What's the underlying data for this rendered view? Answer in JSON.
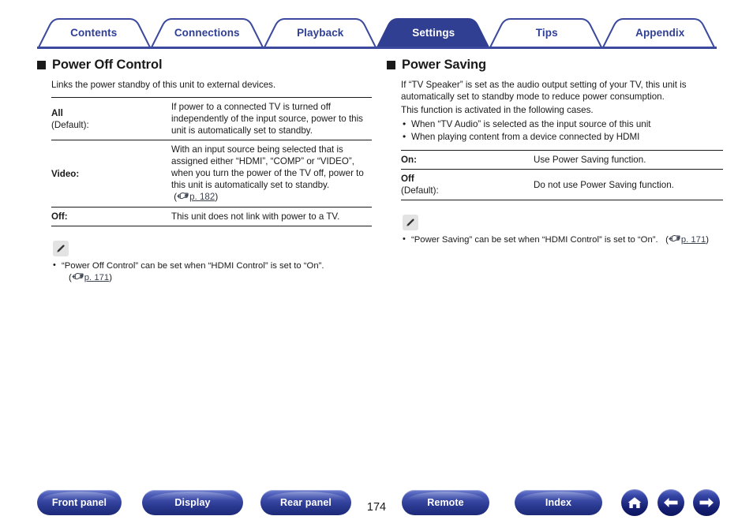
{
  "nav": {
    "tabs": [
      {
        "label": "Contents",
        "active": false
      },
      {
        "label": "Connections",
        "active": false
      },
      {
        "label": "Playback",
        "active": false
      },
      {
        "label": "Settings",
        "active": true
      },
      {
        "label": "Tips",
        "active": false
      },
      {
        "label": "Appendix",
        "active": false
      }
    ]
  },
  "left": {
    "title": "Power Off Control",
    "lead": "Links the power standby of this unit to external devices.",
    "table": [
      {
        "option": "All",
        "option_suffix": "(Default):",
        "desc": "If power to a connected TV is turned off independently of the input source, power to this unit is automatically set to standby."
      },
      {
        "option": "Video:",
        "option_suffix": "",
        "desc": "With an input source being selected that is assigned either “HDMI”, “COMP” or “VIDEO”, when you turn the power of the TV off, power to this unit is automatically set to standby.",
        "ref": "p. 182"
      },
      {
        "option": "Off:",
        "option_suffix": "",
        "desc": "This unit does not link with power to a TV."
      }
    ],
    "note": {
      "text": "“Power Off Control” can be set when “HDMI Control” is set to “On”.",
      "ref": "p. 171"
    }
  },
  "right": {
    "title": "Power Saving",
    "lead": "If “TV Speaker” is set as the audio output setting of your TV, this unit is automatically set to standby mode to reduce power consumption.",
    "lead2": "This function is activated in the following cases.",
    "bullets": [
      "When “TV Audio” is selected as the input source of this unit",
      "When playing content from a device connected by HDMI"
    ],
    "table": [
      {
        "option": "On:",
        "option_suffix": "",
        "desc": "Use Power Saving function."
      },
      {
        "option": "Off",
        "option_suffix": "(Default):",
        "desc": "Do not use Power Saving function."
      }
    ],
    "note": {
      "text": "“Power Saving” can be set when “HDMI Control” is set to “On”.",
      "ref": "p. 171"
    }
  },
  "footer": {
    "buttons": [
      {
        "label": "Front panel"
      },
      {
        "label": "Display"
      },
      {
        "label": "Rear panel"
      },
      {
        "label": "Remote"
      },
      {
        "label": "Index"
      }
    ],
    "page_number": "174",
    "icons": [
      "home-icon",
      "arrow-left-icon",
      "arrow-right-icon"
    ]
  },
  "colors": {
    "brand_blue": "#2f3f96",
    "rule_blue": "#3b4a9e",
    "text": "#1a1a1a",
    "link": "#3b4250",
    "note_icon_bg": "#e3e3e3"
  }
}
